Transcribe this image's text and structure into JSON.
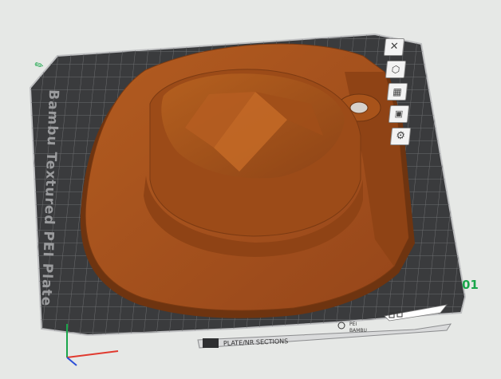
{
  "app": {
    "viewport": "3d-build-plate-view"
  },
  "plate": {
    "label": "Bambu Textured PEI Plate",
    "number": "01",
    "bottom_strip_text": "PLATE/NR SECTIONS",
    "bottom_strip_text2": "PEI",
    "bottom_strip_text3": "BAMBU",
    "bed_color": "#3c3d3f",
    "grid_color": "#6b6c6e"
  },
  "model": {
    "name": "hat-with-keyring",
    "color": "#a8531a",
    "shade_color": "#7d3b10"
  },
  "plate_toolbar": {
    "buttons": [
      {
        "name": "remove-plate-icon",
        "glyph": "✕"
      },
      {
        "name": "auto-orient-icon",
        "glyph": "⬡"
      },
      {
        "name": "arrange-icon",
        "glyph": "▦"
      },
      {
        "name": "lock-icon",
        "glyph": "🔒"
      },
      {
        "name": "settings-icon",
        "glyph": "⚙"
      }
    ]
  },
  "axes": {
    "x_color": "#e03a2f",
    "y_color": "#1aa64b",
    "z_color": "#2b4fd8"
  }
}
